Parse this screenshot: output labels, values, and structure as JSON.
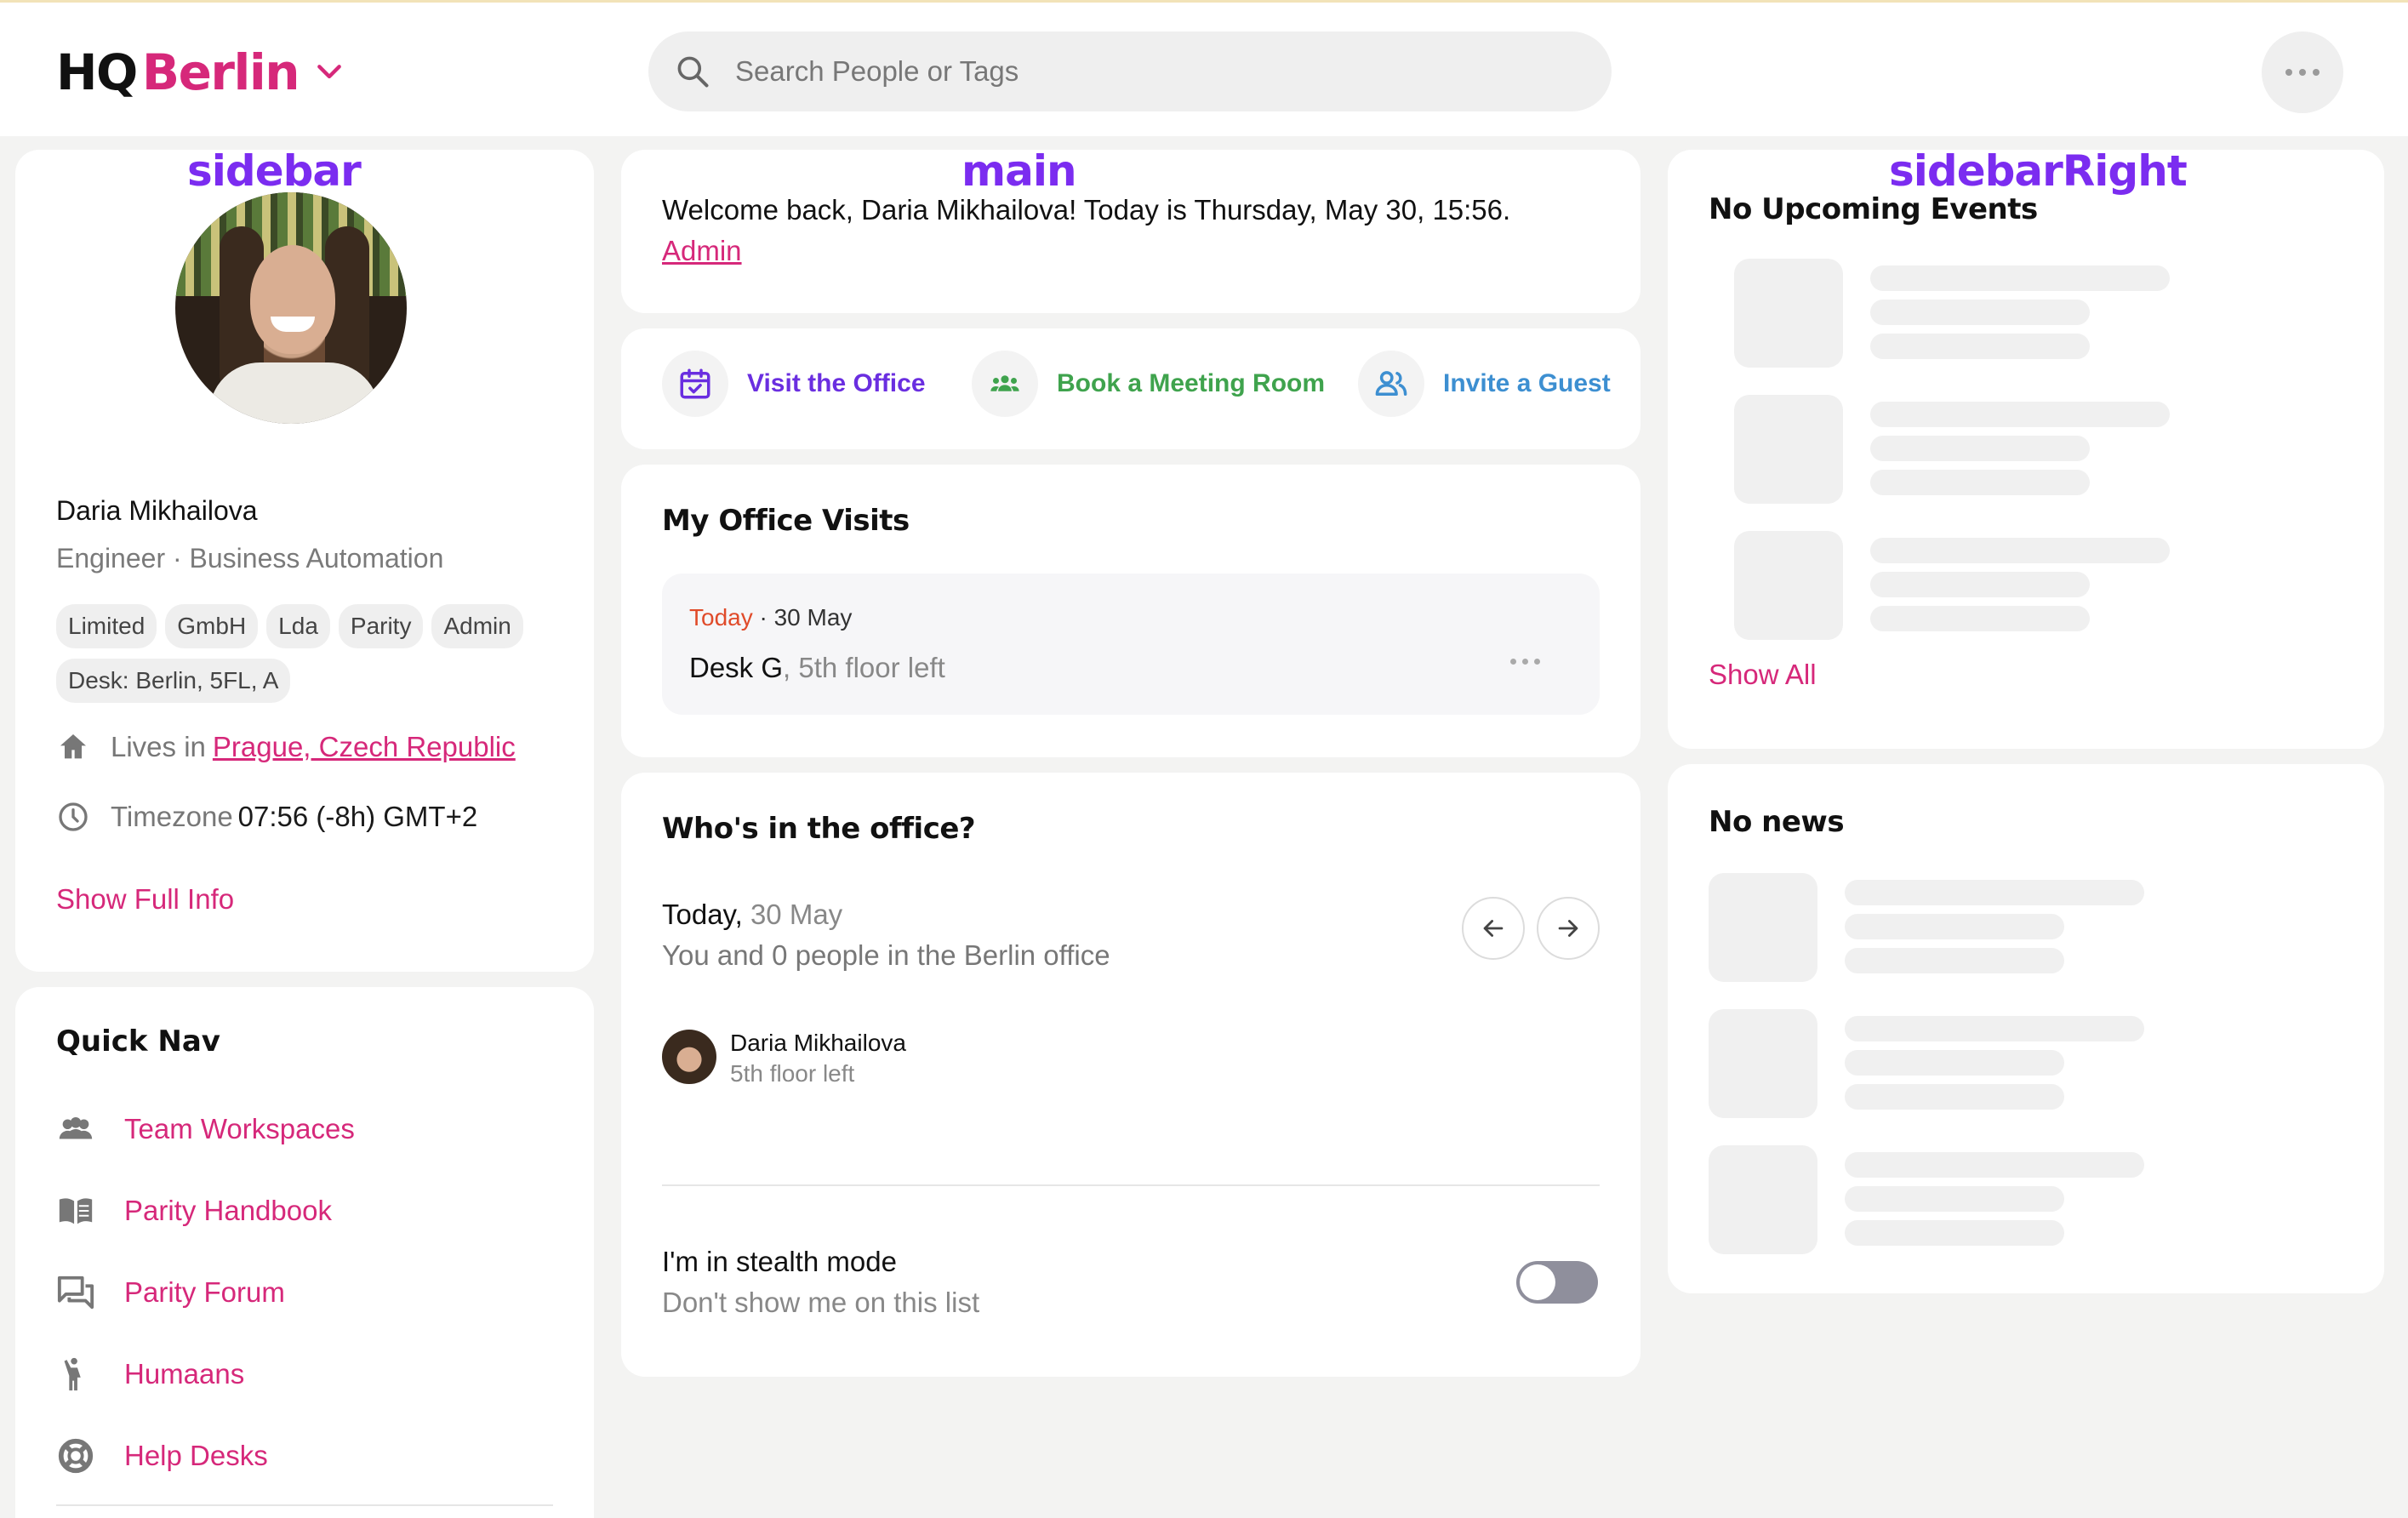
{
  "header": {
    "brand_prefix": "HQ",
    "brand_city": "Berlin",
    "search_placeholder": "Search People or Tags"
  },
  "labels": {
    "sidebar": "sidebar",
    "main": "main",
    "sidebar_right": "sidebarRight"
  },
  "profile": {
    "name": "Daria Mikhailova",
    "role": "Engineer · Business Automation",
    "tags": [
      "Limited",
      "GmbH",
      "Lda",
      "Parity",
      "Admin",
      "Desk: Berlin, 5FL, A"
    ],
    "lives_label": "Lives in",
    "lives_value": "Prague, Czech Republic",
    "timezone_label": "Timezone",
    "timezone_value": "07:56 (-8h) GMT+2",
    "show_full_info": "Show Full Info"
  },
  "quick_nav": {
    "title": "Quick Nav",
    "items": [
      {
        "label": "Team Workspaces",
        "icon": "people-group-icon"
      },
      {
        "label": "Parity Handbook",
        "icon": "book-icon"
      },
      {
        "label": "Parity Forum",
        "icon": "forum-icon"
      },
      {
        "label": "Humaans",
        "icon": "person-waving-icon"
      },
      {
        "label": "Help Desks",
        "icon": "lifebuoy-icon"
      }
    ]
  },
  "main": {
    "welcome": "Welcome back, Daria Mikhailova! Today is Thursday, May 30, 15:56.",
    "admin_link": "Admin",
    "actions": [
      {
        "label": "Visit the Office",
        "color": "#6a2ee0",
        "icon": "calendar-check-icon"
      },
      {
        "label": "Book a Meeting Room",
        "color": "#3fa34d",
        "icon": "group-icon"
      },
      {
        "label": "Invite a Guest",
        "color": "#3d8fd1",
        "icon": "add-user-icon"
      }
    ],
    "visits": {
      "title": "My Office Visits",
      "date_today": "Today",
      "date_rest": "· 30 May",
      "desk": "Desk G",
      "desk_location": ", 5th floor left"
    },
    "whos_in": {
      "title": "Who's in the office?",
      "day_prefix": "Today,",
      "day_date": "30 May",
      "count_text": "You and 0 people in the Berlin office",
      "person_name": "Daria Mikhailova",
      "person_floor": "5th floor left",
      "stealth_title": "I'm in stealth mode",
      "stealth_sub": "Don't show me on this list",
      "stealth_on": false
    }
  },
  "right": {
    "events_title": "No Upcoming Events",
    "show_all": "Show All",
    "news_title": "No news"
  },
  "colors": {
    "accent_pink": "#d6287a",
    "label_purple": "#7b2cf0"
  }
}
